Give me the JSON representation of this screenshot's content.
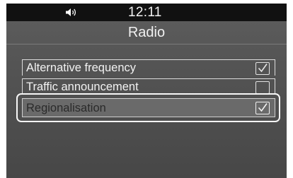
{
  "status_bar": {
    "icon": "volume-icon",
    "time": "12:11"
  },
  "header": {
    "title": "Radio"
  },
  "settings": [
    {
      "label": "Alternative frequency",
      "checked": true,
      "selected": false
    },
    {
      "label": "Traffic announcement",
      "checked": false,
      "selected": false
    },
    {
      "label": "Regionalisation",
      "checked": true,
      "selected": true
    }
  ],
  "colors": {
    "background": "#545454",
    "status_bar": "#111111",
    "text": "#f2f2f2",
    "selected_row": "#6a6a6a",
    "focus_ring": "#f7f7f7"
  }
}
